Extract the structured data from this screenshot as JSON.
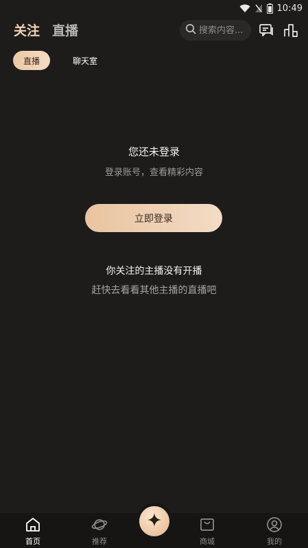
{
  "status_bar": {
    "time": "10:49"
  },
  "header": {
    "tabs": [
      {
        "label": "关注",
        "active": true
      },
      {
        "label": "直播",
        "active": false
      }
    ],
    "search": {
      "placeholder": "搜索内容..."
    }
  },
  "sub_tabs": [
    {
      "label": "直播",
      "active": true
    },
    {
      "label": "聊天室",
      "active": false
    }
  ],
  "empty_state": {
    "title": "您还未登录",
    "subtitle": "登录账号，查看精彩内容",
    "login_button": "立即登录",
    "no_live_title": "你关注的主播没有开播",
    "no_live_subtitle": "赶快去看看其他主播的直播吧"
  },
  "bottom_nav": {
    "items": [
      {
        "label": "首页",
        "icon": "home-icon",
        "active": true
      },
      {
        "label": "推荐",
        "icon": "planet-icon",
        "active": false
      },
      {
        "label": "商城",
        "icon": "shopping-bag-icon",
        "active": false
      },
      {
        "label": "我的",
        "icon": "user-icon",
        "active": false
      }
    ],
    "center_icon": "sparkle-icon"
  },
  "colors": {
    "background": "#1e1c1b",
    "accent_gold": "#f1d3b3",
    "button_gold": "#ecc8a4"
  }
}
